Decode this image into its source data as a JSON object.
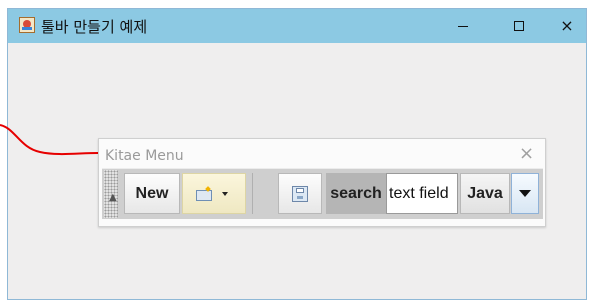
{
  "window": {
    "title": "툴바 만들기 예제",
    "controls": {
      "minimize": "–",
      "maximize": "□",
      "close": "×"
    }
  },
  "toolbar_window": {
    "title": "Kitae Menu",
    "close": "×"
  },
  "toolbar": {
    "new_label": "New",
    "search_label": "search",
    "text_field_value": "text field",
    "combo_selected": "Java"
  },
  "icons": {
    "app": "java-cup-icon",
    "open": "folder-open-icon",
    "save": "save-icon",
    "combo": "chevron-down-icon"
  },
  "colors": {
    "titlebar": "#8cc9e3",
    "arrow": "#e60000"
  }
}
